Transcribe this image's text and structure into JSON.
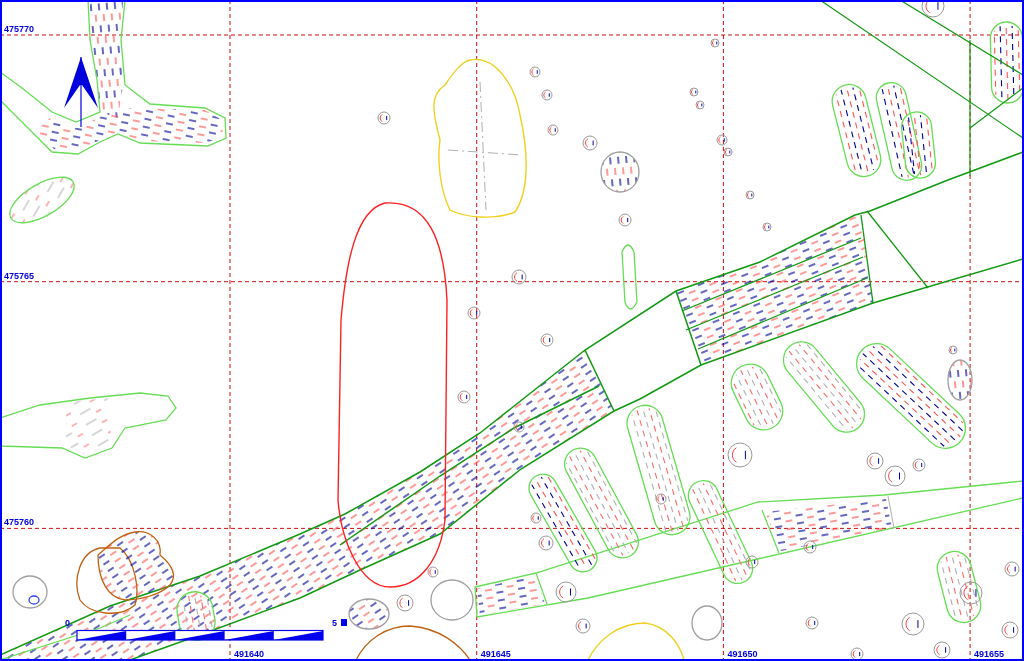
{
  "map": {
    "northing_labels": [
      "475770",
      "475765",
      "475760"
    ],
    "easting_labels": [
      "491640",
      "491645",
      "491650",
      "491655"
    ],
    "scale_bar": {
      "start_label": "0",
      "end_label": "5"
    }
  }
}
